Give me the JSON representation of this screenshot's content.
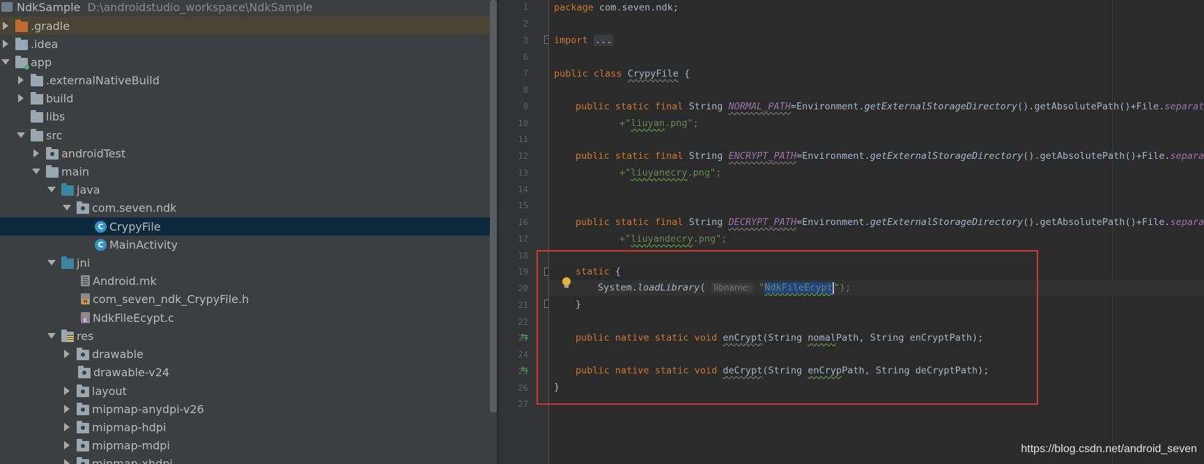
{
  "project": {
    "name": "NdkSample",
    "path": "D:\\androidstudio_workspace\\NdkSample"
  },
  "tree": {
    "gradle": ".gradle",
    "idea": ".idea",
    "app": "app",
    "externalNativeBuild": ".externalNativeBuild",
    "build": "build",
    "libs": "libs",
    "src": "src",
    "androidTest": "androidTest",
    "main": "main",
    "java": "java",
    "package": "com.seven.ndk",
    "crypyFile": "CrypyFile",
    "mainActivity": "MainActivity",
    "jni": "jni",
    "androidMk": "Android.mk",
    "header": "com_seven_ndk_CrypyFile.h",
    "cfile": "NdkFileEcypt.c",
    "res": "res",
    "drawable": "drawable",
    "drawableV24": "drawable-v24",
    "layout": "layout",
    "mipmapAnydpi": "mipmap-anydpi-v26",
    "mipmapHdpi": "mipmap-hdpi",
    "mipmapMdpi": "mipmap-mdpi",
    "mipmapXhdpi": "mipmap-xhdpi"
  },
  "editor": {
    "line_numbers": [
      "1",
      "2",
      "3",
      "6",
      "7",
      "8",
      "9",
      "10",
      "11",
      "12",
      "13",
      "14",
      "15",
      "16",
      "17",
      "18",
      "19",
      "20",
      "21",
      "22",
      "23",
      "24",
      "25",
      "26",
      "27"
    ],
    "code": {
      "kw_package": "package",
      "pkg_name": " com.seven.ndk;",
      "kw_import": "import",
      "import_fold": "...",
      "kw_public": "public",
      "kw_class": "class",
      "class_name": "CrypyFile",
      "brace_open": " {",
      "kw_public_static_final": "public static final",
      "type_string": " String ",
      "normal_path": "NORMAL_PATH",
      "encrypt_path": "ENCRYPT_PATH",
      "decrypt_path": "DECRYPT_PATH",
      "env_prefix": "=Environment.",
      "get_ext": "getExternalStorageDirectory",
      "get_abs": "().getAbsolutePath()+File.",
      "separator": "separator",
      "plus_quote": "+\"",
      "str_liuyan": "liuyan",
      "str_liuyanecry": "liuyanecry",
      "str_liuyandecry": "liuyandecry",
      "png_end": ".png\";",
      "kw_static": "static",
      "system": "System.",
      "load_library": "loadLibrary",
      "paren_open": "( ",
      "hint_libname": "libname:",
      "quote": "\"",
      "lib_name": "NdkFileEcypt",
      "close_call": "\");",
      "brace_close": "}",
      "kw_public_native_static_void": "public native static void",
      "m_encrypt": "enCrypt",
      "enc_params_a": "(String ",
      "nomal_path": "nomal",
      "path_word": "Path",
      "enc_params_b": ", String enCryptPath);",
      "m_decrypt": "deCrypt",
      "encryp": "enCryp",
      "dec_params_b": ", String deCryptPath);"
    }
  },
  "watermark": "https://blog.csdn.net/android_seven"
}
